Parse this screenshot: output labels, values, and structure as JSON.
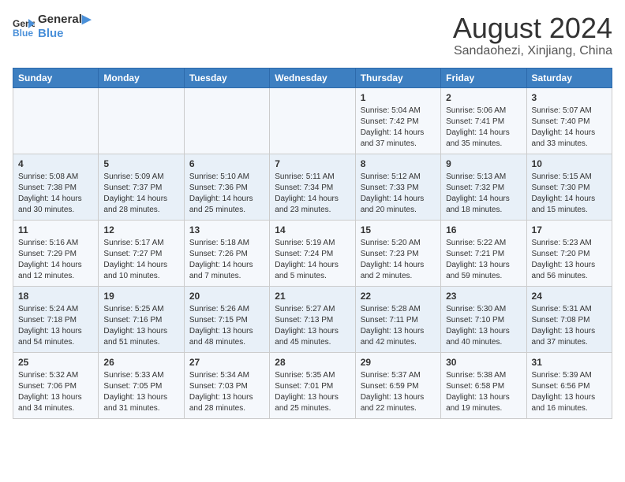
{
  "logo": {
    "line1": "General",
    "line2": "Blue"
  },
  "title": "August 2024",
  "subtitle": "Sandaohezi, Xinjiang, China",
  "days_of_week": [
    "Sunday",
    "Monday",
    "Tuesday",
    "Wednesday",
    "Thursday",
    "Friday",
    "Saturday"
  ],
  "weeks": [
    [
      {
        "num": "",
        "info": ""
      },
      {
        "num": "",
        "info": ""
      },
      {
        "num": "",
        "info": ""
      },
      {
        "num": "",
        "info": ""
      },
      {
        "num": "1",
        "info": "Sunrise: 5:04 AM\nSunset: 7:42 PM\nDaylight: 14 hours\nand 37 minutes."
      },
      {
        "num": "2",
        "info": "Sunrise: 5:06 AM\nSunset: 7:41 PM\nDaylight: 14 hours\nand 35 minutes."
      },
      {
        "num": "3",
        "info": "Sunrise: 5:07 AM\nSunset: 7:40 PM\nDaylight: 14 hours\nand 33 minutes."
      }
    ],
    [
      {
        "num": "4",
        "info": "Sunrise: 5:08 AM\nSunset: 7:38 PM\nDaylight: 14 hours\nand 30 minutes."
      },
      {
        "num": "5",
        "info": "Sunrise: 5:09 AM\nSunset: 7:37 PM\nDaylight: 14 hours\nand 28 minutes."
      },
      {
        "num": "6",
        "info": "Sunrise: 5:10 AM\nSunset: 7:36 PM\nDaylight: 14 hours\nand 25 minutes."
      },
      {
        "num": "7",
        "info": "Sunrise: 5:11 AM\nSunset: 7:34 PM\nDaylight: 14 hours\nand 23 minutes."
      },
      {
        "num": "8",
        "info": "Sunrise: 5:12 AM\nSunset: 7:33 PM\nDaylight: 14 hours\nand 20 minutes."
      },
      {
        "num": "9",
        "info": "Sunrise: 5:13 AM\nSunset: 7:32 PM\nDaylight: 14 hours\nand 18 minutes."
      },
      {
        "num": "10",
        "info": "Sunrise: 5:15 AM\nSunset: 7:30 PM\nDaylight: 14 hours\nand 15 minutes."
      }
    ],
    [
      {
        "num": "11",
        "info": "Sunrise: 5:16 AM\nSunset: 7:29 PM\nDaylight: 14 hours\nand 12 minutes."
      },
      {
        "num": "12",
        "info": "Sunrise: 5:17 AM\nSunset: 7:27 PM\nDaylight: 14 hours\nand 10 minutes."
      },
      {
        "num": "13",
        "info": "Sunrise: 5:18 AM\nSunset: 7:26 PM\nDaylight: 14 hours\nand 7 minutes."
      },
      {
        "num": "14",
        "info": "Sunrise: 5:19 AM\nSunset: 7:24 PM\nDaylight: 14 hours\nand 5 minutes."
      },
      {
        "num": "15",
        "info": "Sunrise: 5:20 AM\nSunset: 7:23 PM\nDaylight: 14 hours\nand 2 minutes."
      },
      {
        "num": "16",
        "info": "Sunrise: 5:22 AM\nSunset: 7:21 PM\nDaylight: 13 hours\nand 59 minutes."
      },
      {
        "num": "17",
        "info": "Sunrise: 5:23 AM\nSunset: 7:20 PM\nDaylight: 13 hours\nand 56 minutes."
      }
    ],
    [
      {
        "num": "18",
        "info": "Sunrise: 5:24 AM\nSunset: 7:18 PM\nDaylight: 13 hours\nand 54 minutes."
      },
      {
        "num": "19",
        "info": "Sunrise: 5:25 AM\nSunset: 7:16 PM\nDaylight: 13 hours\nand 51 minutes."
      },
      {
        "num": "20",
        "info": "Sunrise: 5:26 AM\nSunset: 7:15 PM\nDaylight: 13 hours\nand 48 minutes."
      },
      {
        "num": "21",
        "info": "Sunrise: 5:27 AM\nSunset: 7:13 PM\nDaylight: 13 hours\nand 45 minutes."
      },
      {
        "num": "22",
        "info": "Sunrise: 5:28 AM\nSunset: 7:11 PM\nDaylight: 13 hours\nand 42 minutes."
      },
      {
        "num": "23",
        "info": "Sunrise: 5:30 AM\nSunset: 7:10 PM\nDaylight: 13 hours\nand 40 minutes."
      },
      {
        "num": "24",
        "info": "Sunrise: 5:31 AM\nSunset: 7:08 PM\nDaylight: 13 hours\nand 37 minutes."
      }
    ],
    [
      {
        "num": "25",
        "info": "Sunrise: 5:32 AM\nSunset: 7:06 PM\nDaylight: 13 hours\nand 34 minutes."
      },
      {
        "num": "26",
        "info": "Sunrise: 5:33 AM\nSunset: 7:05 PM\nDaylight: 13 hours\nand 31 minutes."
      },
      {
        "num": "27",
        "info": "Sunrise: 5:34 AM\nSunset: 7:03 PM\nDaylight: 13 hours\nand 28 minutes."
      },
      {
        "num": "28",
        "info": "Sunrise: 5:35 AM\nSunset: 7:01 PM\nDaylight: 13 hours\nand 25 minutes."
      },
      {
        "num": "29",
        "info": "Sunrise: 5:37 AM\nSunset: 6:59 PM\nDaylight: 13 hours\nand 22 minutes."
      },
      {
        "num": "30",
        "info": "Sunrise: 5:38 AM\nSunset: 6:58 PM\nDaylight: 13 hours\nand 19 minutes."
      },
      {
        "num": "31",
        "info": "Sunrise: 5:39 AM\nSunset: 6:56 PM\nDaylight: 13 hours\nand 16 minutes."
      }
    ]
  ]
}
